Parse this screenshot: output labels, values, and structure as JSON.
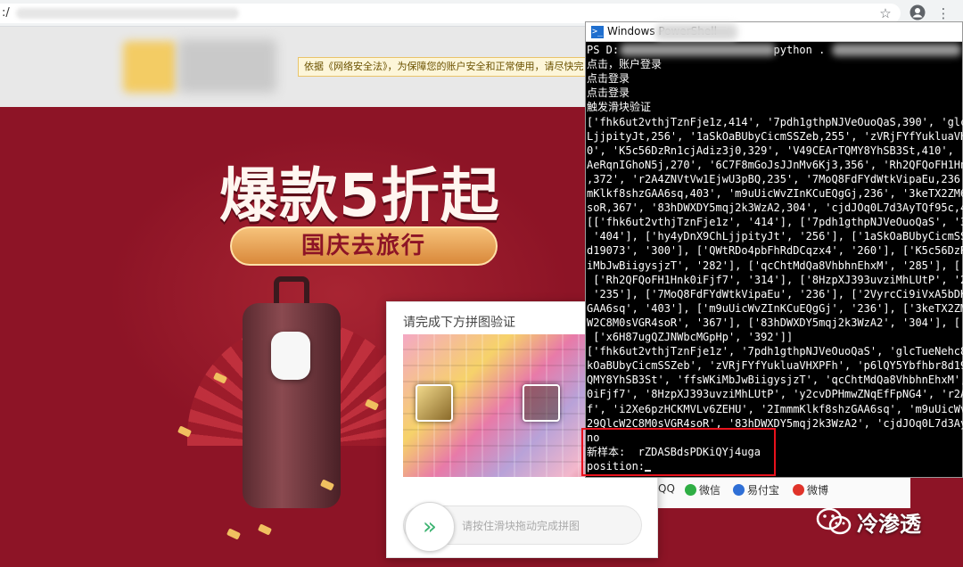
{
  "browser": {
    "url_prefix": ":/",
    "icons": [
      "star-icon",
      "account-icon",
      "menu-dots-icon"
    ]
  },
  "page": {
    "notice_text": "依据《网络安全法》，为保障您的账户安全和正常使用，请尽快完",
    "headline": "爆款5折起",
    "subheadline": "国庆去旅行",
    "social_links": [
      {
        "label": "QQ",
        "color": "#2d8ad6"
      },
      {
        "label": "微信",
        "color": "#2fae44"
      },
      {
        "label": "易付宝",
        "color": "#2f6fd6"
      },
      {
        "label": "微博",
        "color": "#e0332a"
      }
    ]
  },
  "captcha": {
    "title": "请完成下方拼图验证",
    "slider_hint": "请按住滑块拖动完成拼图",
    "slider_arrow": "»"
  },
  "powershell": {
    "title": "Windows PowerShell",
    "icon_glyph": ">_",
    "lines": [
      {
        "text": "PS D:                        python ."
      },
      {
        "text": "点击，账户登录"
      },
      {
        "text": "点击登录"
      },
      {
        "text": "点击登录"
      },
      {
        "text": "触发滑块验证"
      },
      {
        "text": "['fhk6ut2vthjTznFje1z,414', '7pdh1gthpNJVeOuoQaS,390', 'glcTueN"
      },
      {
        "text": "LjjpityJt,256', '1aSkOaBUbyCicmSSZeb,255', 'zVRjFYfYukluaVHXPFh"
      },
      {
        "text": "0', 'K5c56DzRn1cjAdiz3j0,329', 'V49CEArTQMY8YhSB3St,410', 'ffsW"
      },
      {
        "text": "AeRqnIGhoN5j,270', '6C7F8mGoJsJJnMv6Kj3,356', 'Rh2QFQoFH1Hnk0iF"
      },
      {
        "text": ",372', 'r2A4ZNVtVw1EjwU3pBQ,235', '7MoQ8FdFYdWtkVipaEu,236', '2"
      },
      {
        "text": "mKlkf8shzGAA6sq,403', 'm9uUicWvZInKCuEQgGj,236', '3keTX2ZM6QkfA"
      },
      {
        "text": "soR,367', '83hDWXDY5mqj2k3WzA2,304', 'cjdJOq0L7d3AyTQf95c,420',"
      },
      {
        "text": "[['fhk6ut2vthjTznFje1z', '414'], ['7pdh1gthpNJVeOuoQaS', '390']"
      },
      {
        "text": " '404'], ['hy4yDnX9ChLjjpityJt', '256'], ['1aSkOaBUbyCicmSSZeb'"
      },
      {
        "text": "d19073', '300'], ['QWtRDo4pbFhRdDCqzx4', '260'], ['K5c56DzRn1cj"
      },
      {
        "text": "iMbJwBiigysjzT', '282'], ['qcChtMdQa8VhbhnEhxM', '285'], ['bKVs"
      },
      {
        "text": " ['Rh2QFQoFH1Hnk0iFjf7', '314'], ['8HzpXJ393uvziMhLUtP', '293'"
      },
      {
        "text": " '235'], ['7MoQ8FdFYdWtkVipaEu', '236'], ['2VyrcCi9iVxA5bDKWJf'"
      },
      {
        "text": "GAA6sq', '403'], ['m9uUicWvZInKCuEQgGj', '236'], ['3keTX2ZM6Qkf"
      },
      {
        "text": "W2C8M0sVGR4soR', '367'], ['83hDWXDY5mqj2k3WzA2', '304'], ['cjdJ"
      },
      {
        "text": " ['x6H87ugQZJNWbcMGpHp', '392']]"
      },
      {
        "text": "['fhk6ut2vthjTznFje1z', '7pdh1gthpNJVeOuoQaS', 'glcTueNehc8DsZ6"
      },
      {
        "text": "kOaBUbyCicmSSZeb', 'zVRjFYfYukluaVHXPFh', 'p6lQY5Ybfhbr8d19073'"
      },
      {
        "text": "QMY8YhSB3St', 'ffsWKiMbJwBiigysjzT', 'qcChtMdQa8VhbhnEhxM', 'bK"
      },
      {
        "text": "0iFjf7', '8HzpXJ393uvziMhLUtP', 'y2cvDPHmwZNqEfFpNG4', 'r2A4ZNV"
      },
      {
        "text": "f', 'i2Xe6pzHCKMVLv6ZEHU', '2ImmmKlkf8shzGAA6sq', 'm9uUicWvZInK"
      },
      {
        "text": "29QlcW2C8M0sVGR4soR', '83hDWXDY5mqj2k3WzA2', 'cjdJOq0L7d3AyTQf9"
      },
      {
        "text": "no"
      },
      {
        "text": "新样本:  rZDASBdsPDKiQYj4uga"
      },
      {
        "text": "position:"
      }
    ]
  },
  "watermark": {
    "text": "冷渗透"
  }
}
